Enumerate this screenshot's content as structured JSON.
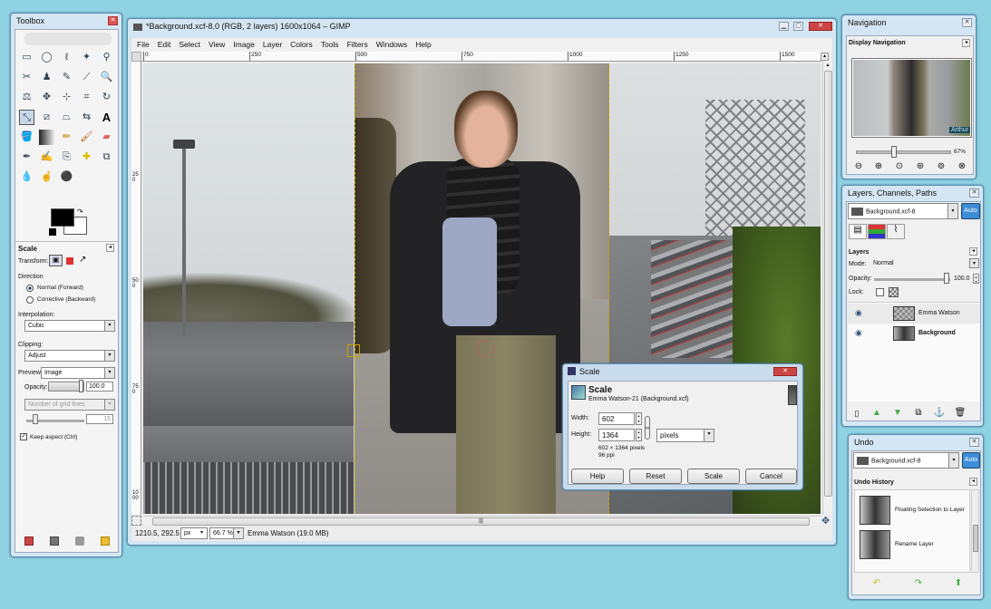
{
  "toolbox": {
    "title": "Toolbox",
    "tool_options_title": "Scale",
    "transform_label": "Transform:",
    "direction_label": "Direction",
    "direction_normal": "Normal (Forward)",
    "direction_corrective": "Corrective (Backward)",
    "interpolation_label": "Interpolation:",
    "interpolation_value": "Cubic",
    "clipping_label": "Clipping:",
    "clipping_value": "Adjust",
    "preview_label": "Preview:",
    "preview_value": "Image",
    "opacity_label": "Opacity:",
    "opacity_value": "100.0",
    "grid_value": "Number of grid lines",
    "grid_count": "15",
    "keep_aspect": "Keep aspect  (Ctrl)"
  },
  "main": {
    "title": "*Background.xcf-8.0 (RGB, 2 layers) 1600x1064 – GIMP",
    "menu": [
      "File",
      "Edit",
      "Select",
      "View",
      "Image",
      "Layer",
      "Colors",
      "Tools",
      "Filters",
      "Windows",
      "Help"
    ],
    "ruler_h": [
      "0",
      "250",
      "500",
      "750",
      "1000",
      "1250",
      "1500"
    ],
    "ruler_v": [
      "250",
      "500",
      "750",
      "1000"
    ],
    "status_coords": "1210.5, 292.5",
    "status_unit": "px",
    "status_zoom": "66.7 %",
    "status_info": "Emma Watson (19.0 MB)"
  },
  "scale_dialog": {
    "title": "Scale",
    "heading": "Scale",
    "subheading": "Emma Watson-21 (Background.xcf)",
    "width_label": "Width:",
    "width_value": "602",
    "height_label": "Height:",
    "height_value": "1364",
    "unit": "pixels",
    "size_info": "602 × 1364 pixels",
    "ppi_info": "96 ppi",
    "help": "Help",
    "reset": "Reset",
    "scale": "Scale",
    "cancel": "Cancel"
  },
  "navigation": {
    "title": "Navigation",
    "subtitle": "Display Navigation",
    "zoom": "67%",
    "watermark": "Arthur"
  },
  "layers": {
    "title": "Layers, Channels, Paths",
    "image_combo": "Background.xcf-8",
    "auto": "Auto",
    "section": "Layers",
    "mode_label": "Mode:",
    "mode_value": "Normal",
    "opacity_label": "Opacity:",
    "opacity_value": "100.0",
    "lock_label": "Lock:",
    "items": [
      {
        "name": "Emma Watson",
        "bold": false
      },
      {
        "name": "Background",
        "bold": true
      }
    ]
  },
  "undo": {
    "title": "Undo",
    "image_combo": "Background.xcf-8",
    "auto": "Auto",
    "section": "Undo History",
    "items": [
      "Floating Selection to Layer",
      "Rename Layer"
    ]
  },
  "colors": {
    "chrome": "#d4e6f3",
    "canvas_bg": "#c9ccd0",
    "selection": "#c8a000"
  }
}
